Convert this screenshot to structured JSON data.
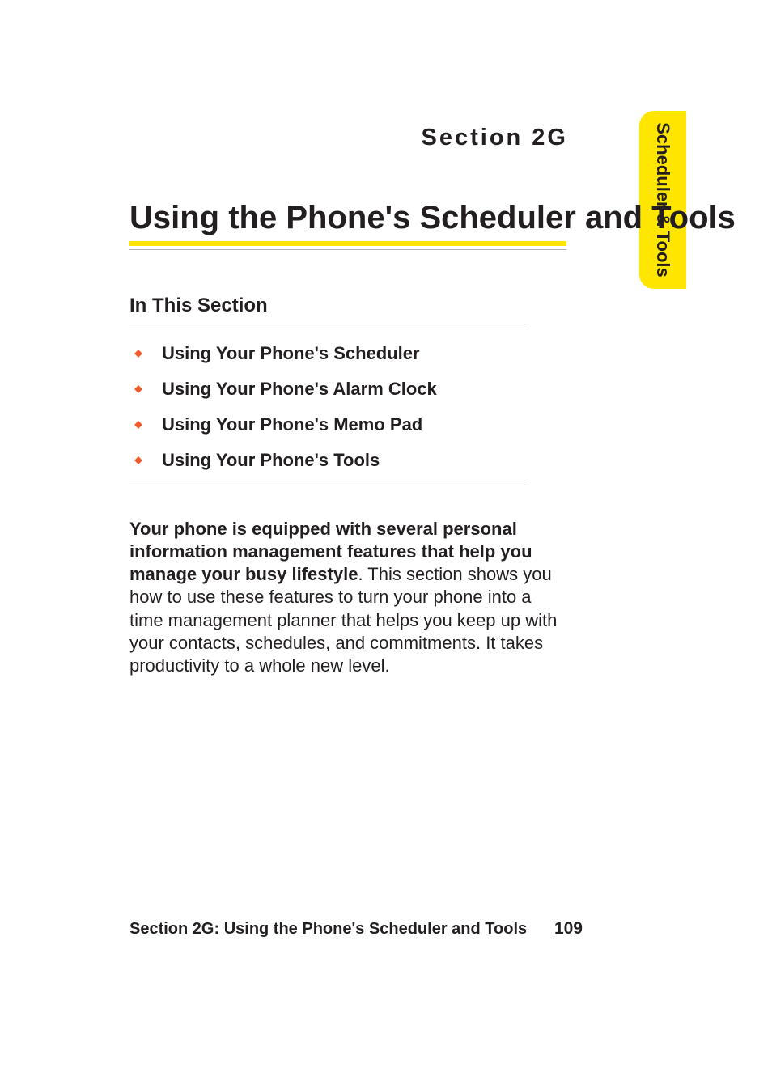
{
  "side_tab": {
    "label": "Scheduler & Tools"
  },
  "header": {
    "section_label": "Section 2G",
    "title": "Using the Phone's Scheduler and Tools"
  },
  "subhead": "In This Section",
  "toc": [
    {
      "label": "Using Your Phone's Scheduler"
    },
    {
      "label": "Using Your Phone's Alarm Clock"
    },
    {
      "label": "Using Your Phone's Memo Pad"
    },
    {
      "label": "Using Your Phone's Tools"
    }
  ],
  "intro": {
    "bold": "Your phone is equipped with several personal information management features that help you manage your busy lifestyle",
    "rest": ". This section shows you how to use these features to turn your phone into a time management planner that helps you keep up with your contacts, schedules, and commitments. It takes productivity to a whole new level."
  },
  "footer": {
    "text": "Section 2G: Using the Phone's Scheduler and Tools",
    "page": "109"
  },
  "colors": {
    "accent": "#ffe600",
    "bullet": "#f15a29"
  }
}
